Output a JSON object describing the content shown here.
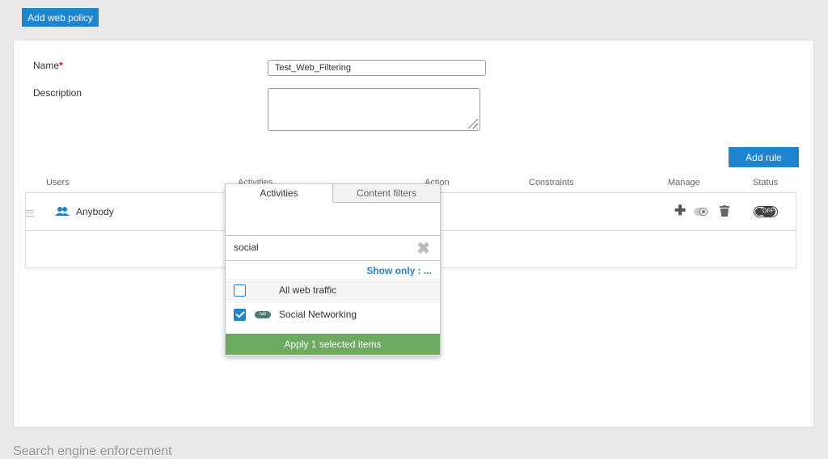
{
  "toolbar": {
    "add_policy_label": "Add web policy"
  },
  "form": {
    "name_label": "Name",
    "name_required": "*",
    "name_value": "Test_Web_Filtering",
    "description_label": "Description"
  },
  "rules": {
    "add_rule_label": "Add rule",
    "columns": [
      "Users",
      "Activities",
      "Action",
      "Constraints",
      "Manage",
      "Status"
    ],
    "row1": {
      "user": "Anybody",
      "status": "OFF"
    }
  },
  "dropdown": {
    "tabs": [
      "Activities",
      "Content filters"
    ],
    "search_value": "social",
    "show_only_label": "Show only : ...",
    "options": [
      {
        "label": "All web traffic",
        "checked": false
      },
      {
        "label": "Social Networking",
        "checked": true,
        "badge": "cat"
      }
    ],
    "apply_label": "Apply 1 selected items"
  },
  "section_title": "Search engine enforcement",
  "colors": {
    "primary": "#1e84d0",
    "apply": "#6caa5f",
    "required": "#d0161f"
  }
}
